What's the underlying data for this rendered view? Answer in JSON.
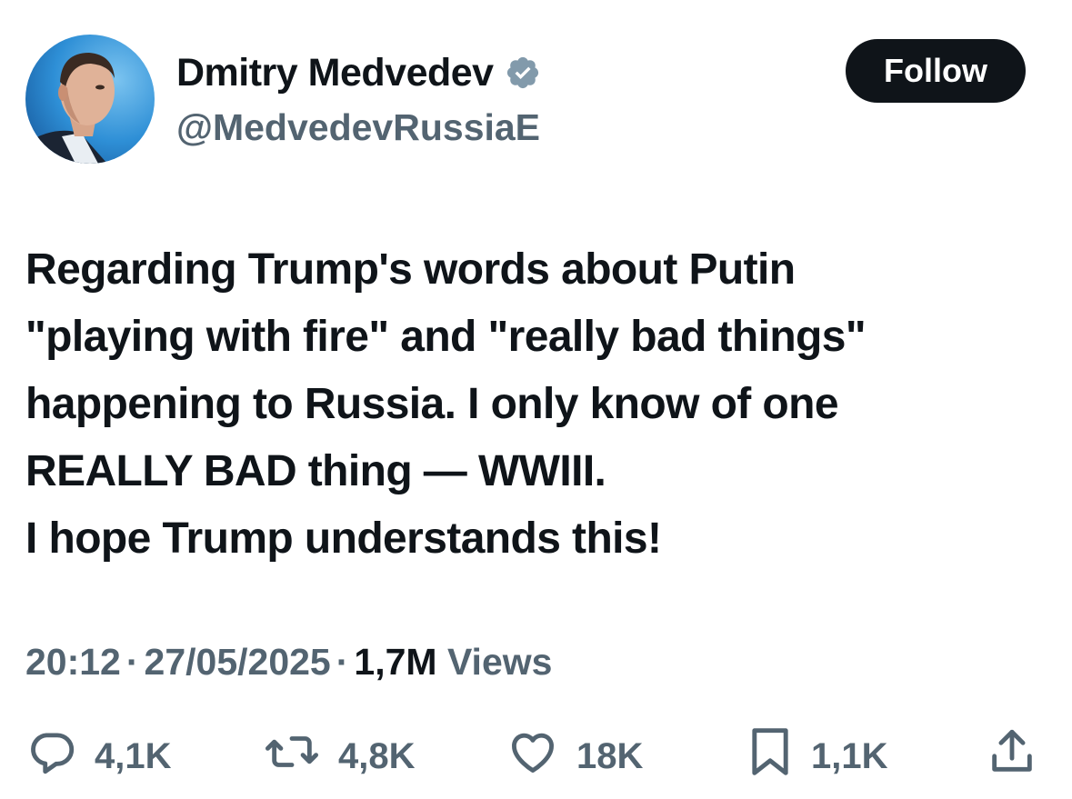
{
  "author": {
    "display_name": "Dmitry Medvedev",
    "handle": "@MedvedevRussiaE",
    "verified_badge_color": "#829aab"
  },
  "follow_button": {
    "label": "Follow"
  },
  "tweet": {
    "lines": [
      "Regarding Trump's words about Putin",
      "\"playing with fire\" and \"really bad things\"",
      "happening to Russia. I only know of one",
      "REALLY BAD thing — WWIII.",
      "I hope Trump understands this!"
    ]
  },
  "meta": {
    "time": "20:12",
    "separator": "·",
    "date": "27/05/2025",
    "views_count": "1,7M",
    "views_label": "Views"
  },
  "actions": {
    "replies": {
      "icon": "reply-icon",
      "count": "4,1K"
    },
    "reposts": {
      "icon": "repost-icon",
      "count": "4,8K"
    },
    "likes": {
      "icon": "heart-icon",
      "count": "18K"
    },
    "bookmarks": {
      "icon": "bookmark-icon",
      "count": "1,1K"
    },
    "share": {
      "icon": "share-icon"
    }
  },
  "colors": {
    "text_primary": "#0f1419",
    "text_secondary": "#536471",
    "follow_bg": "#0f1419",
    "avatar_bg": "#2e8fd6"
  }
}
